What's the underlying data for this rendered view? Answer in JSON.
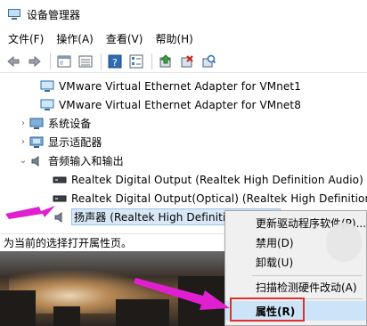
{
  "window": {
    "title": "设备管理器"
  },
  "menu": [
    {
      "label": "文件(F)"
    },
    {
      "label": "操作(A)"
    },
    {
      "label": "查看(V)"
    },
    {
      "label": "帮助(H)"
    }
  ],
  "toolbar": {
    "icons": [
      "back-arrow-icon",
      "forward-arrow-icon",
      "properties-pane-icon",
      "view-icon",
      "help-icon",
      "device-list-icon",
      "update-driver-icon",
      "uninstall-device-icon",
      "scan-hardware-icon"
    ]
  },
  "tree": {
    "rows": [
      {
        "label": "VMware Virtual Ethernet Adapter for VMnet1",
        "icon": "network-adapter-icon",
        "level": 2
      },
      {
        "label": "VMware Virtual Ethernet Adapter for VMnet8",
        "icon": "network-adapter-icon",
        "level": 2
      },
      {
        "label": "系统设备",
        "icon": "system-device-icon",
        "level": 1,
        "expander": "›"
      },
      {
        "label": "显示适配器",
        "icon": "display-adapter-icon",
        "level": 1,
        "expander": "›"
      },
      {
        "label": "音频输入和输出",
        "icon": "audio-icon",
        "level": 1,
        "expander": "⌄"
      },
      {
        "label": "Realtek Digital Output (Realtek High Definition Audio)",
        "icon": "digital-output-icon",
        "level": 2
      },
      {
        "label": "Realtek Digital Output(Optical) (Realtek High Definition Audio)",
        "icon": "digital-output-icon",
        "level": 2
      },
      {
        "label": "扬声器 (Realtek High Definition Audio)",
        "icon": "speaker-icon",
        "level": 2,
        "selected": true
      }
    ]
  },
  "status": {
    "text": "为当前的选择打开属性页。"
  },
  "context_menu": {
    "items": [
      {
        "label": "更新驱动程序软件(P)..."
      },
      {
        "label": "禁用(D)"
      },
      {
        "label": "卸载(U)"
      },
      {
        "label": "扫描检测硬件改动(A)"
      },
      {
        "label": "属性(R)",
        "highlighted": true
      }
    ]
  },
  "colors": {
    "selection": "#d9e8f7",
    "highlight_box": "#e0302c",
    "arrow": "#e020d0"
  }
}
